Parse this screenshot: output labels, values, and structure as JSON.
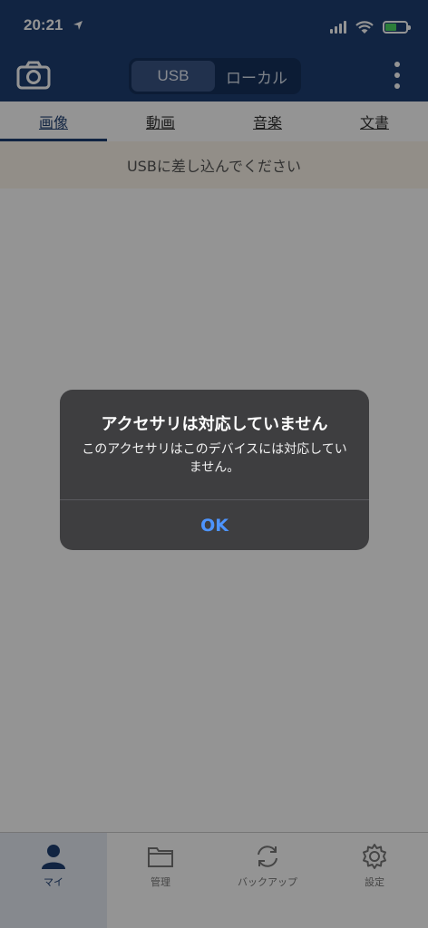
{
  "status": {
    "time": "20:21"
  },
  "header": {
    "segments": [
      {
        "label": "USB",
        "active": true
      },
      {
        "label": "ローカル",
        "active": false
      }
    ]
  },
  "tabs": [
    {
      "label": "画像",
      "active": true
    },
    {
      "label": "動画",
      "active": false
    },
    {
      "label": "音楽",
      "active": false
    },
    {
      "label": "文書",
      "active": false
    }
  ],
  "notice": {
    "text": "USBに差し込んでください"
  },
  "tabbar": [
    {
      "label": "マイ",
      "icon": "person-icon",
      "active": true
    },
    {
      "label": "管理",
      "icon": "folder-icon",
      "active": false
    },
    {
      "label": "バックアップ",
      "icon": "sync-icon",
      "active": false
    },
    {
      "label": "設定",
      "icon": "gear-icon",
      "active": false
    }
  ],
  "alert": {
    "title": "アクセサリは対応していません",
    "message": "このアクセサリはこのデバイスには対応していません。",
    "ok_label": "OK"
  },
  "colors": {
    "header": "#1e3f73",
    "alert_button": "#4d94ff"
  }
}
